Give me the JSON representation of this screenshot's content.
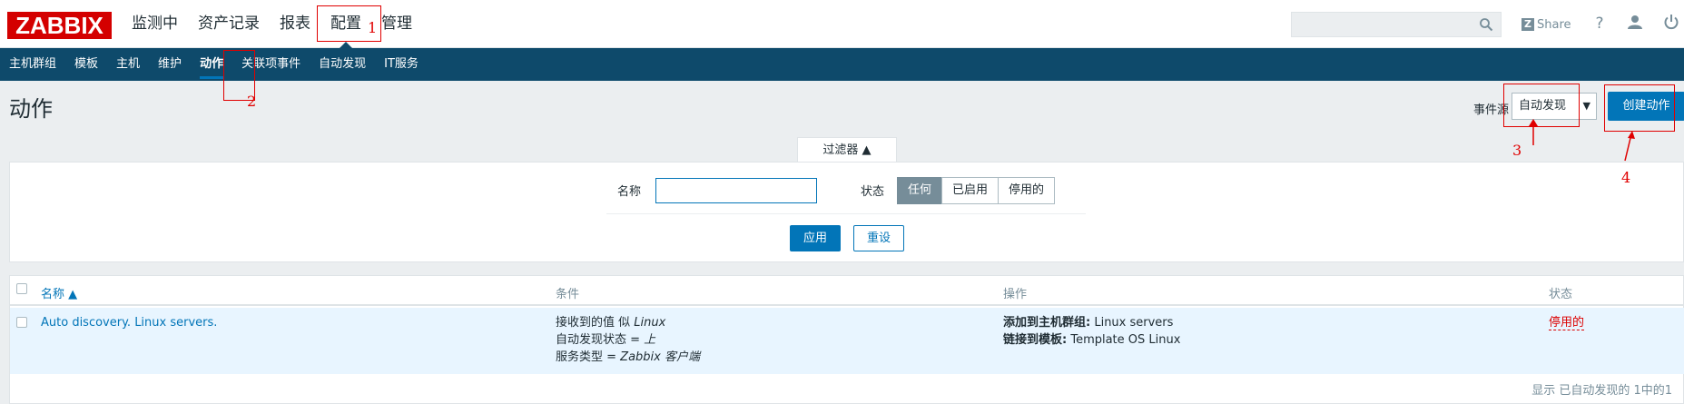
{
  "topbar": {
    "logo": "ZABBIX",
    "menu": [
      {
        "label": "监测中"
      },
      {
        "label": "资产记录"
      },
      {
        "label": "报表"
      },
      {
        "label": "配置"
      },
      {
        "label": "管理"
      }
    ],
    "share_label": "Share",
    "help_glyph": "?",
    "icons": [
      "search-icon",
      "zabbix-share-icon",
      "help-icon",
      "user-icon",
      "power-icon"
    ]
  },
  "subnav": {
    "items": [
      {
        "label": "主机群组"
      },
      {
        "label": "模板"
      },
      {
        "label": "主机"
      },
      {
        "label": "维护"
      },
      {
        "label": "动作"
      },
      {
        "label": "关联项事件"
      },
      {
        "label": "自动发现"
      },
      {
        "label": "IT服务"
      }
    ]
  },
  "header": {
    "title": "动作",
    "event_source_label": "事件源",
    "event_source_value": "自动发现",
    "create_button": "创建动作"
  },
  "filter": {
    "tab_label": "过滤器 ▲",
    "name_label": "名称",
    "name_value": "",
    "status_label": "状态",
    "status_options": [
      "任何",
      "已启用",
      "停用的"
    ],
    "status_selected": "任何",
    "apply_button": "应用",
    "reset_button": "重设"
  },
  "table": {
    "columns": [
      "名称 ▲",
      "条件",
      "操作",
      "状态"
    ],
    "rows": [
      {
        "name": "Auto discovery. Linux servers.",
        "conditions": [
          {
            "text": "接收到的值 似 ",
            "value": "Linux"
          },
          {
            "text": "自动发现状态 = ",
            "value": "上"
          },
          {
            "text": "服务类型 = ",
            "value": "Zabbix 客户端"
          }
        ],
        "operations": [
          {
            "label": "添加到主机群组:",
            "value": " Linux servers"
          },
          {
            "label": "链接到模板:",
            "value": " Template OS Linux"
          }
        ],
        "status": "停用的"
      }
    ],
    "footer": "显示 已自动发现的 1中的1"
  },
  "annotations": [
    "1",
    "2",
    "3",
    "4"
  ],
  "colors": {
    "brand_red": "#d40000",
    "nav_blue": "#0e4a6b",
    "accent": "#0275b8",
    "row_highlight": "#e8f5ff",
    "status_disabled": "#dc0000",
    "annotation": "#e00000"
  }
}
